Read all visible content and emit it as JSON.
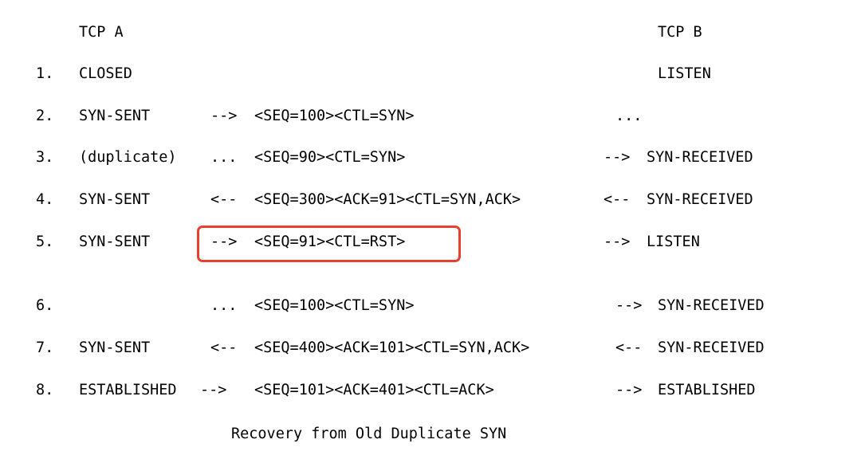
{
  "header": {
    "tcp_a": "TCP A",
    "tcp_b": "TCP B"
  },
  "rows": [
    {
      "num": "1.",
      "a_state": "CLOSED",
      "left_arrow": "",
      "segment": "",
      "right_arrow": "",
      "b_state": "LISTEN"
    },
    {
      "num": "2.",
      "a_state": "SYN-SENT",
      "left_arrow": "-->",
      "segment": "<SEQ=100><CTL=SYN>",
      "right_arrow": "...",
      "b_state": ""
    },
    {
      "num": "3.",
      "a_state": "(duplicate)",
      "left_arrow": "...",
      "segment": "<SEQ=90><CTL=SYN>",
      "right_arrow": "-->",
      "b_state": "SYN-RECEIVED"
    },
    {
      "num": "4.",
      "a_state": "SYN-SENT",
      "left_arrow": "<--",
      "segment": "<SEQ=300><ACK=91><CTL=SYN,ACK>",
      "right_arrow": "<--",
      "b_state": "SYN-RECEIVED"
    },
    {
      "num": "5.",
      "a_state": "SYN-SENT",
      "left_arrow": "-->",
      "segment": "<SEQ=91><CTL=RST>",
      "right_arrow": "-->",
      "b_state": "LISTEN"
    },
    {
      "num": "6.",
      "a_state": "",
      "left_arrow": "...",
      "segment": "<SEQ=100><CTL=SYN>",
      "right_arrow": "-->",
      "b_state": "SYN-RECEIVED"
    },
    {
      "num": "7.",
      "a_state": "SYN-SENT",
      "left_arrow": "<--",
      "segment": "<SEQ=400><ACK=101><CTL=SYN,ACK>",
      "right_arrow": "<--",
      "b_state": "SYN-RECEIVED"
    },
    {
      "num": "8.",
      "a_state": "ESTABLISHED",
      "left_arrow": "-->",
      "segment": "<SEQ=101><ACK=401><CTL=ACK>",
      "right_arrow": "-->",
      "b_state": "ESTABLISHED"
    }
  ],
  "caption": "Recovery from Old Duplicate SYN",
  "highlight_color": "#e8402f"
}
